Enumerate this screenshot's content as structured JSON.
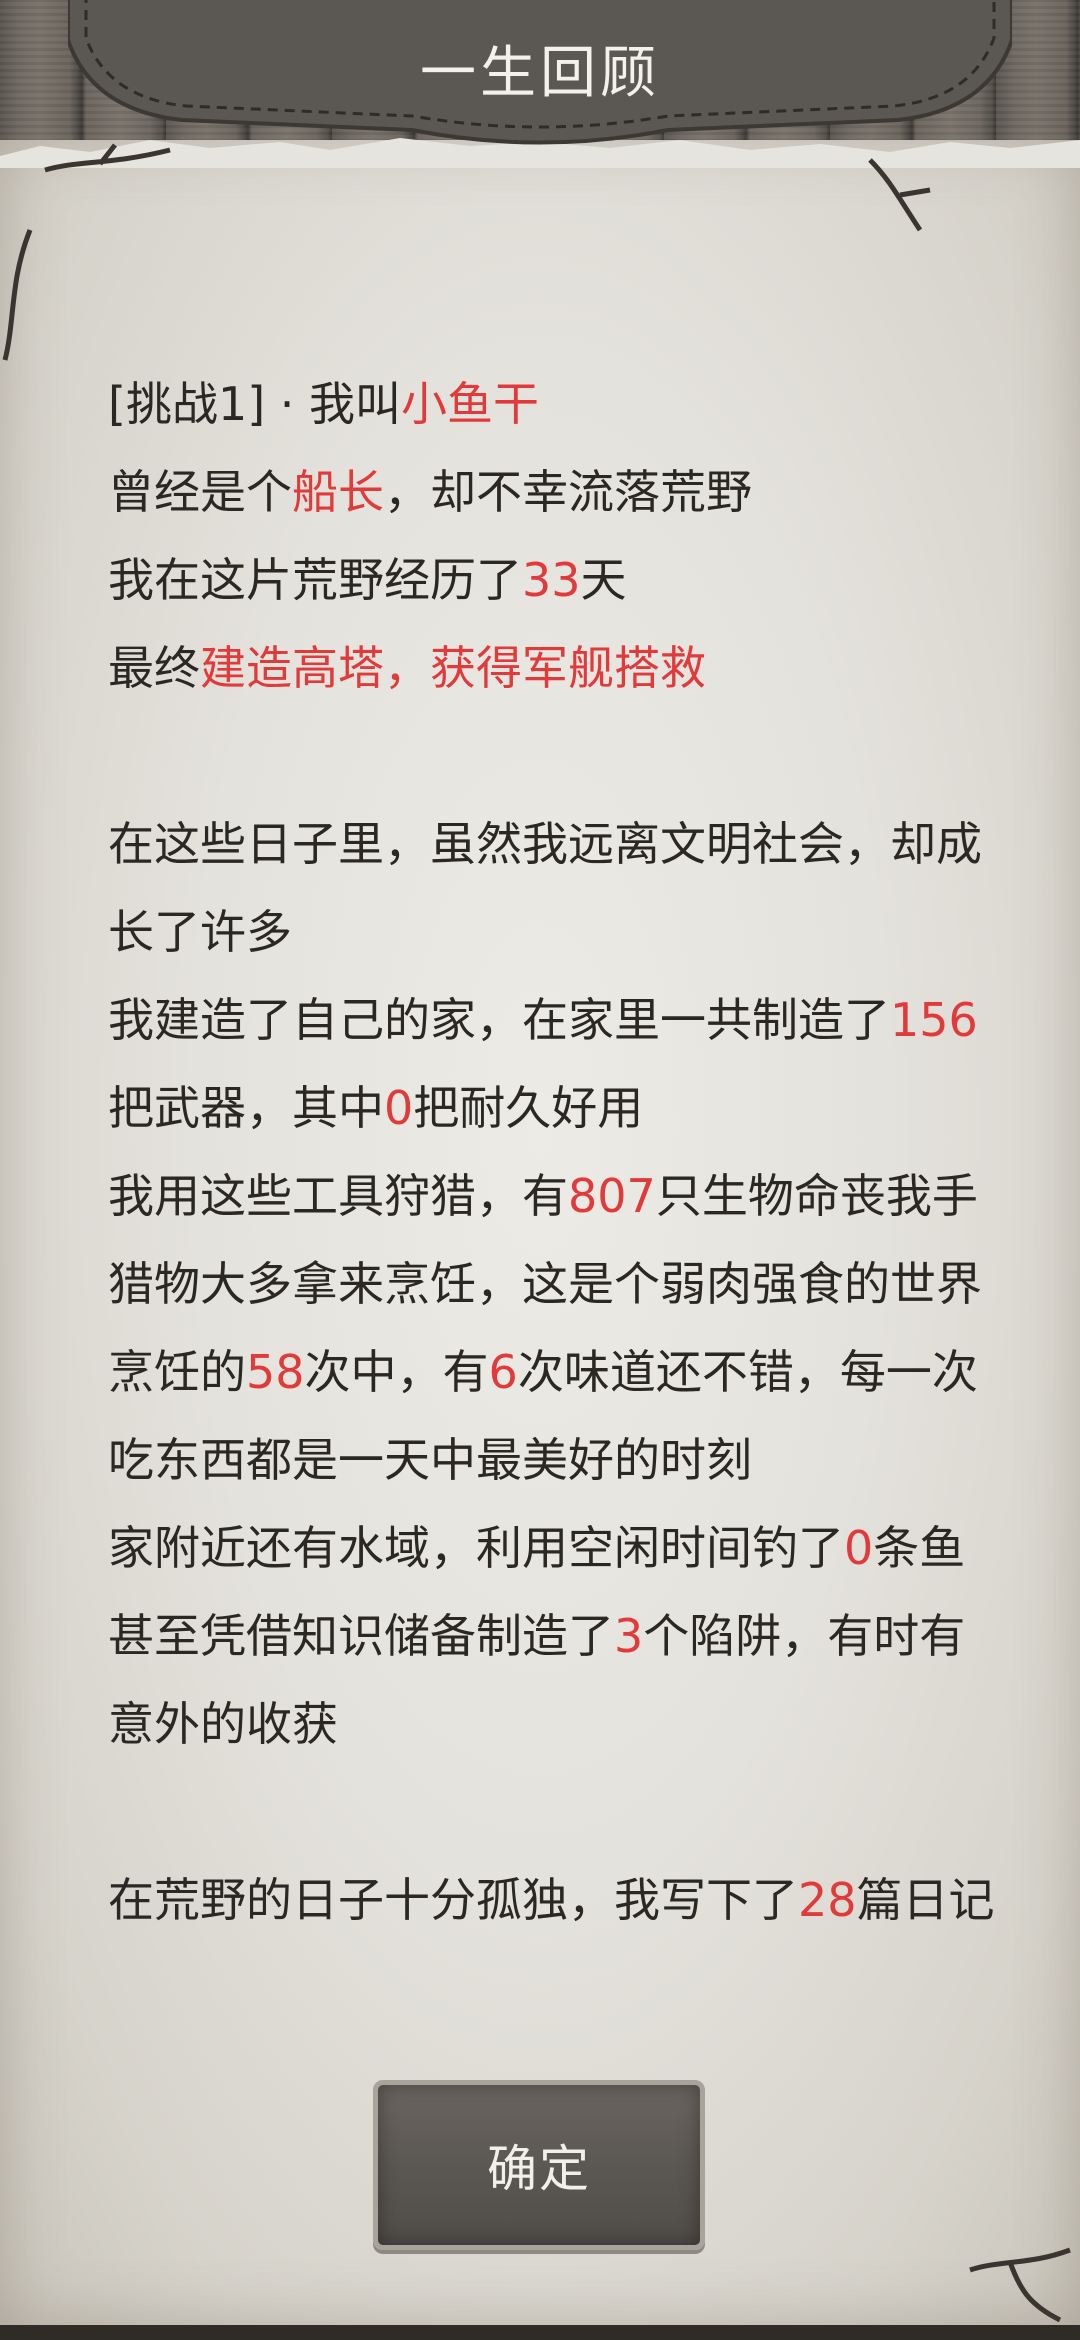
{
  "header": {
    "title": "一生回顾"
  },
  "summary": {
    "block1": [
      [
        {
          "t": "[挑战1] · 我叫"
        },
        {
          "t": "小鱼干",
          "hl": true
        }
      ],
      [
        {
          "t": "曾经是个"
        },
        {
          "t": "船长",
          "hl": true
        },
        {
          "t": "，却不幸流落荒野"
        }
      ],
      [
        {
          "t": "我在这片荒野经历了"
        },
        {
          "t": "33",
          "hl": true
        },
        {
          "t": "天"
        }
      ],
      [
        {
          "t": "最终"
        },
        {
          "t": "建造高塔，获得军舰搭救",
          "hl": true
        }
      ]
    ],
    "block2": [
      [
        {
          "t": "在这些日子里，虽然我远离文明社会，却成"
        }
      ],
      [
        {
          "t": "长了许多"
        }
      ],
      [
        {
          "t": "我建造了自己的家，在家里一共制造了"
        },
        {
          "t": "156",
          "hl": true
        }
      ],
      [
        {
          "t": "把武器，其中"
        },
        {
          "t": "0",
          "hl": true
        },
        {
          "t": "把耐久好用"
        }
      ],
      [
        {
          "t": "我用这些工具狩猎，有"
        },
        {
          "t": "807",
          "hl": true
        },
        {
          "t": "只生物命丧我手"
        }
      ],
      [
        {
          "t": "猎物大多拿来烹饪，这是个弱肉强食的世界"
        }
      ],
      [
        {
          "t": "烹饪的"
        },
        {
          "t": "58",
          "hl": true
        },
        {
          "t": "次中，有"
        },
        {
          "t": "6",
          "hl": true
        },
        {
          "t": "次味道还不错，每一次"
        }
      ],
      [
        {
          "t": "吃东西都是一天中最美好的时刻"
        }
      ],
      [
        {
          "t": "家附近还有水域，利用空闲时间钓了"
        },
        {
          "t": "0",
          "hl": true
        },
        {
          "t": "条鱼"
        }
      ],
      [
        {
          "t": "甚至凭借知识储备制造了"
        },
        {
          "t": "3",
          "hl": true
        },
        {
          "t": "个陷阱，有时有"
        }
      ],
      [
        {
          "t": "意外的收获"
        }
      ]
    ],
    "block3": [
      [
        {
          "t": "在荒野的日子十分孤独，我写下了"
        },
        {
          "t": "28",
          "hl": true
        },
        {
          "t": "篇日记"
        }
      ]
    ]
  },
  "confirm_button": {
    "label": "确定"
  },
  "colors": {
    "highlight": "#e23a3a",
    "text": "#2a2724",
    "banner": "#5b5752",
    "paper": "#e4e2dc"
  }
}
